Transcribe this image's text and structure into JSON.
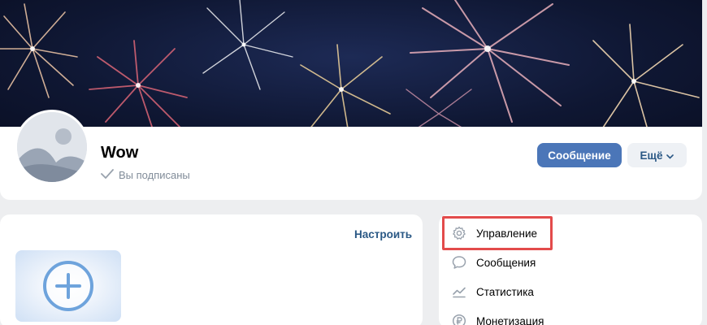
{
  "group": {
    "name": "Wow",
    "subscription_status": "Вы подписаны"
  },
  "actions": {
    "message_label": "Сообщение",
    "more_label": "Ещё"
  },
  "content": {
    "customize_label": "Настроить"
  },
  "menu": {
    "items": [
      {
        "label": "Управление",
        "icon": "gear-icon"
      },
      {
        "label": "Сообщения",
        "icon": "chat-bubble-icon"
      },
      {
        "label": "Статистика",
        "icon": "chart-icon"
      },
      {
        "label": "Монетизация",
        "icon": "ruble-coin-icon"
      }
    ]
  },
  "colors": {
    "accent": "#4b76b8",
    "link": "#2a5885",
    "highlight": "#e34b4b",
    "background": "#edeef0"
  }
}
